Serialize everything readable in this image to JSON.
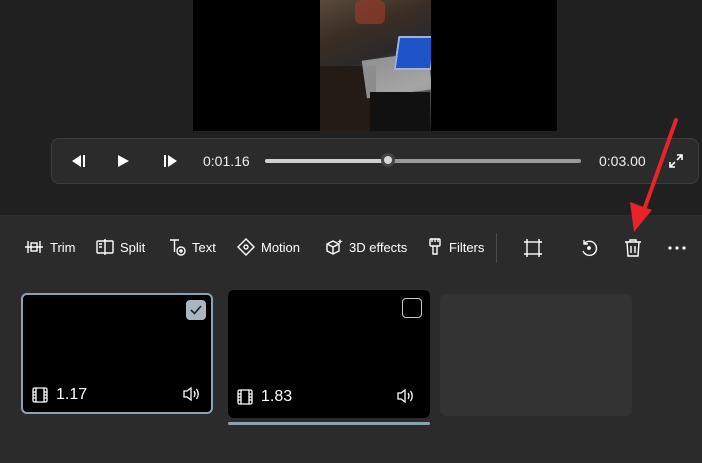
{
  "player": {
    "current_time": "0:01.16",
    "total_time": "0:03.00",
    "progress_fraction": 0.39
  },
  "toolbar": {
    "trim_label": "Trim",
    "split_label": "Split",
    "text_label": "Text",
    "motion_label": "Motion",
    "effects_label": "3D effects",
    "filters_label": "Filters",
    "resize_icon": "resize-crop-icon",
    "rotate_icon": "rotate-icon",
    "delete_icon": "trash-icon",
    "more_icon": "more-dots-icon"
  },
  "storyboard": {
    "clips": [
      {
        "duration": "1.17",
        "selected": true
      },
      {
        "duration": "1.83",
        "selected": false
      }
    ]
  },
  "annotation": {
    "arrow_color": "#e8242a"
  }
}
